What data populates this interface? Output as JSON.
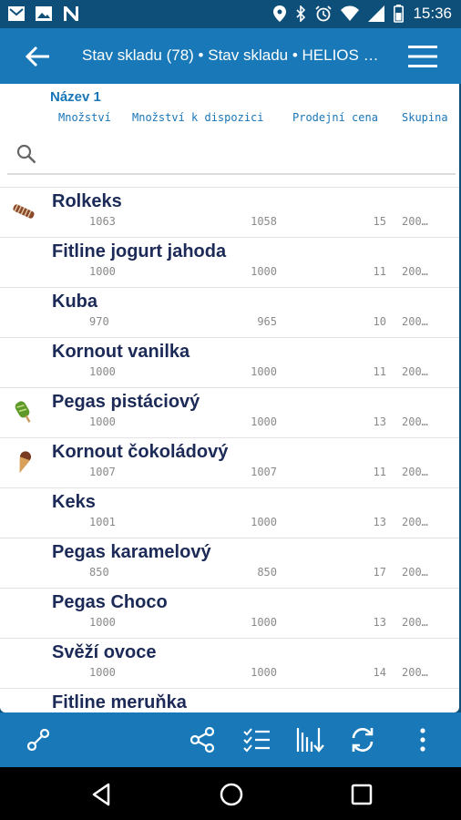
{
  "status_bar": {
    "time": "15:36"
  },
  "app_bar": {
    "title": "Stav skladu (78) • Stav skladu • HELIOS Or..."
  },
  "header": {
    "name_label": "Název 1",
    "columns": [
      "Množství",
      "Množství k dispozici",
      "Prodejní cena",
      "Skupina"
    ]
  },
  "search": {
    "placeholder": ""
  },
  "items": [
    {
      "name": "Rolkeks",
      "qty": "1063",
      "avail": "1058",
      "price": "15",
      "group": "200…",
      "icon": "wafer-roll-icon"
    },
    {
      "name": "Fitline jogurt jahoda",
      "qty": "1000",
      "avail": "1000",
      "price": "11",
      "group": "200…",
      "icon": ""
    },
    {
      "name": "Kuba",
      "qty": "970",
      "avail": "965",
      "price": "10",
      "group": "200…",
      "icon": ""
    },
    {
      "name": "Kornout vanilka",
      "qty": "1000",
      "avail": "1000",
      "price": "11",
      "group": "200…",
      "icon": ""
    },
    {
      "name": "Pegas pistáciový",
      "qty": "1000",
      "avail": "1000",
      "price": "13",
      "group": "200…",
      "icon": "ice-cream-bar-icon"
    },
    {
      "name": "Kornout čokoládový",
      "qty": "1007",
      "avail": "1007",
      "price": "11",
      "group": "200…",
      "icon": "ice-cream-cone-icon"
    },
    {
      "name": "Keks",
      "qty": "1001",
      "avail": "1000",
      "price": "13",
      "group": "200…",
      "icon": ""
    },
    {
      "name": "Pegas karamelový",
      "qty": "850",
      "avail": "850",
      "price": "17",
      "group": "200…",
      "icon": ""
    },
    {
      "name": "Pegas Choco",
      "qty": "1000",
      "avail": "1000",
      "price": "13",
      "group": "200…",
      "icon": ""
    },
    {
      "name": "Svěží ovoce",
      "qty": "1000",
      "avail": "1000",
      "price": "14",
      "group": "200…",
      "icon": ""
    },
    {
      "name": "Fitline meruňka",
      "qty": "",
      "avail": "",
      "price": "",
      "group": "",
      "icon": ""
    }
  ],
  "colors": {
    "app_bar": "#1979b8",
    "status_bar": "#0d4f79",
    "accent": "#1976b8",
    "item_title": "#1c2a57"
  }
}
